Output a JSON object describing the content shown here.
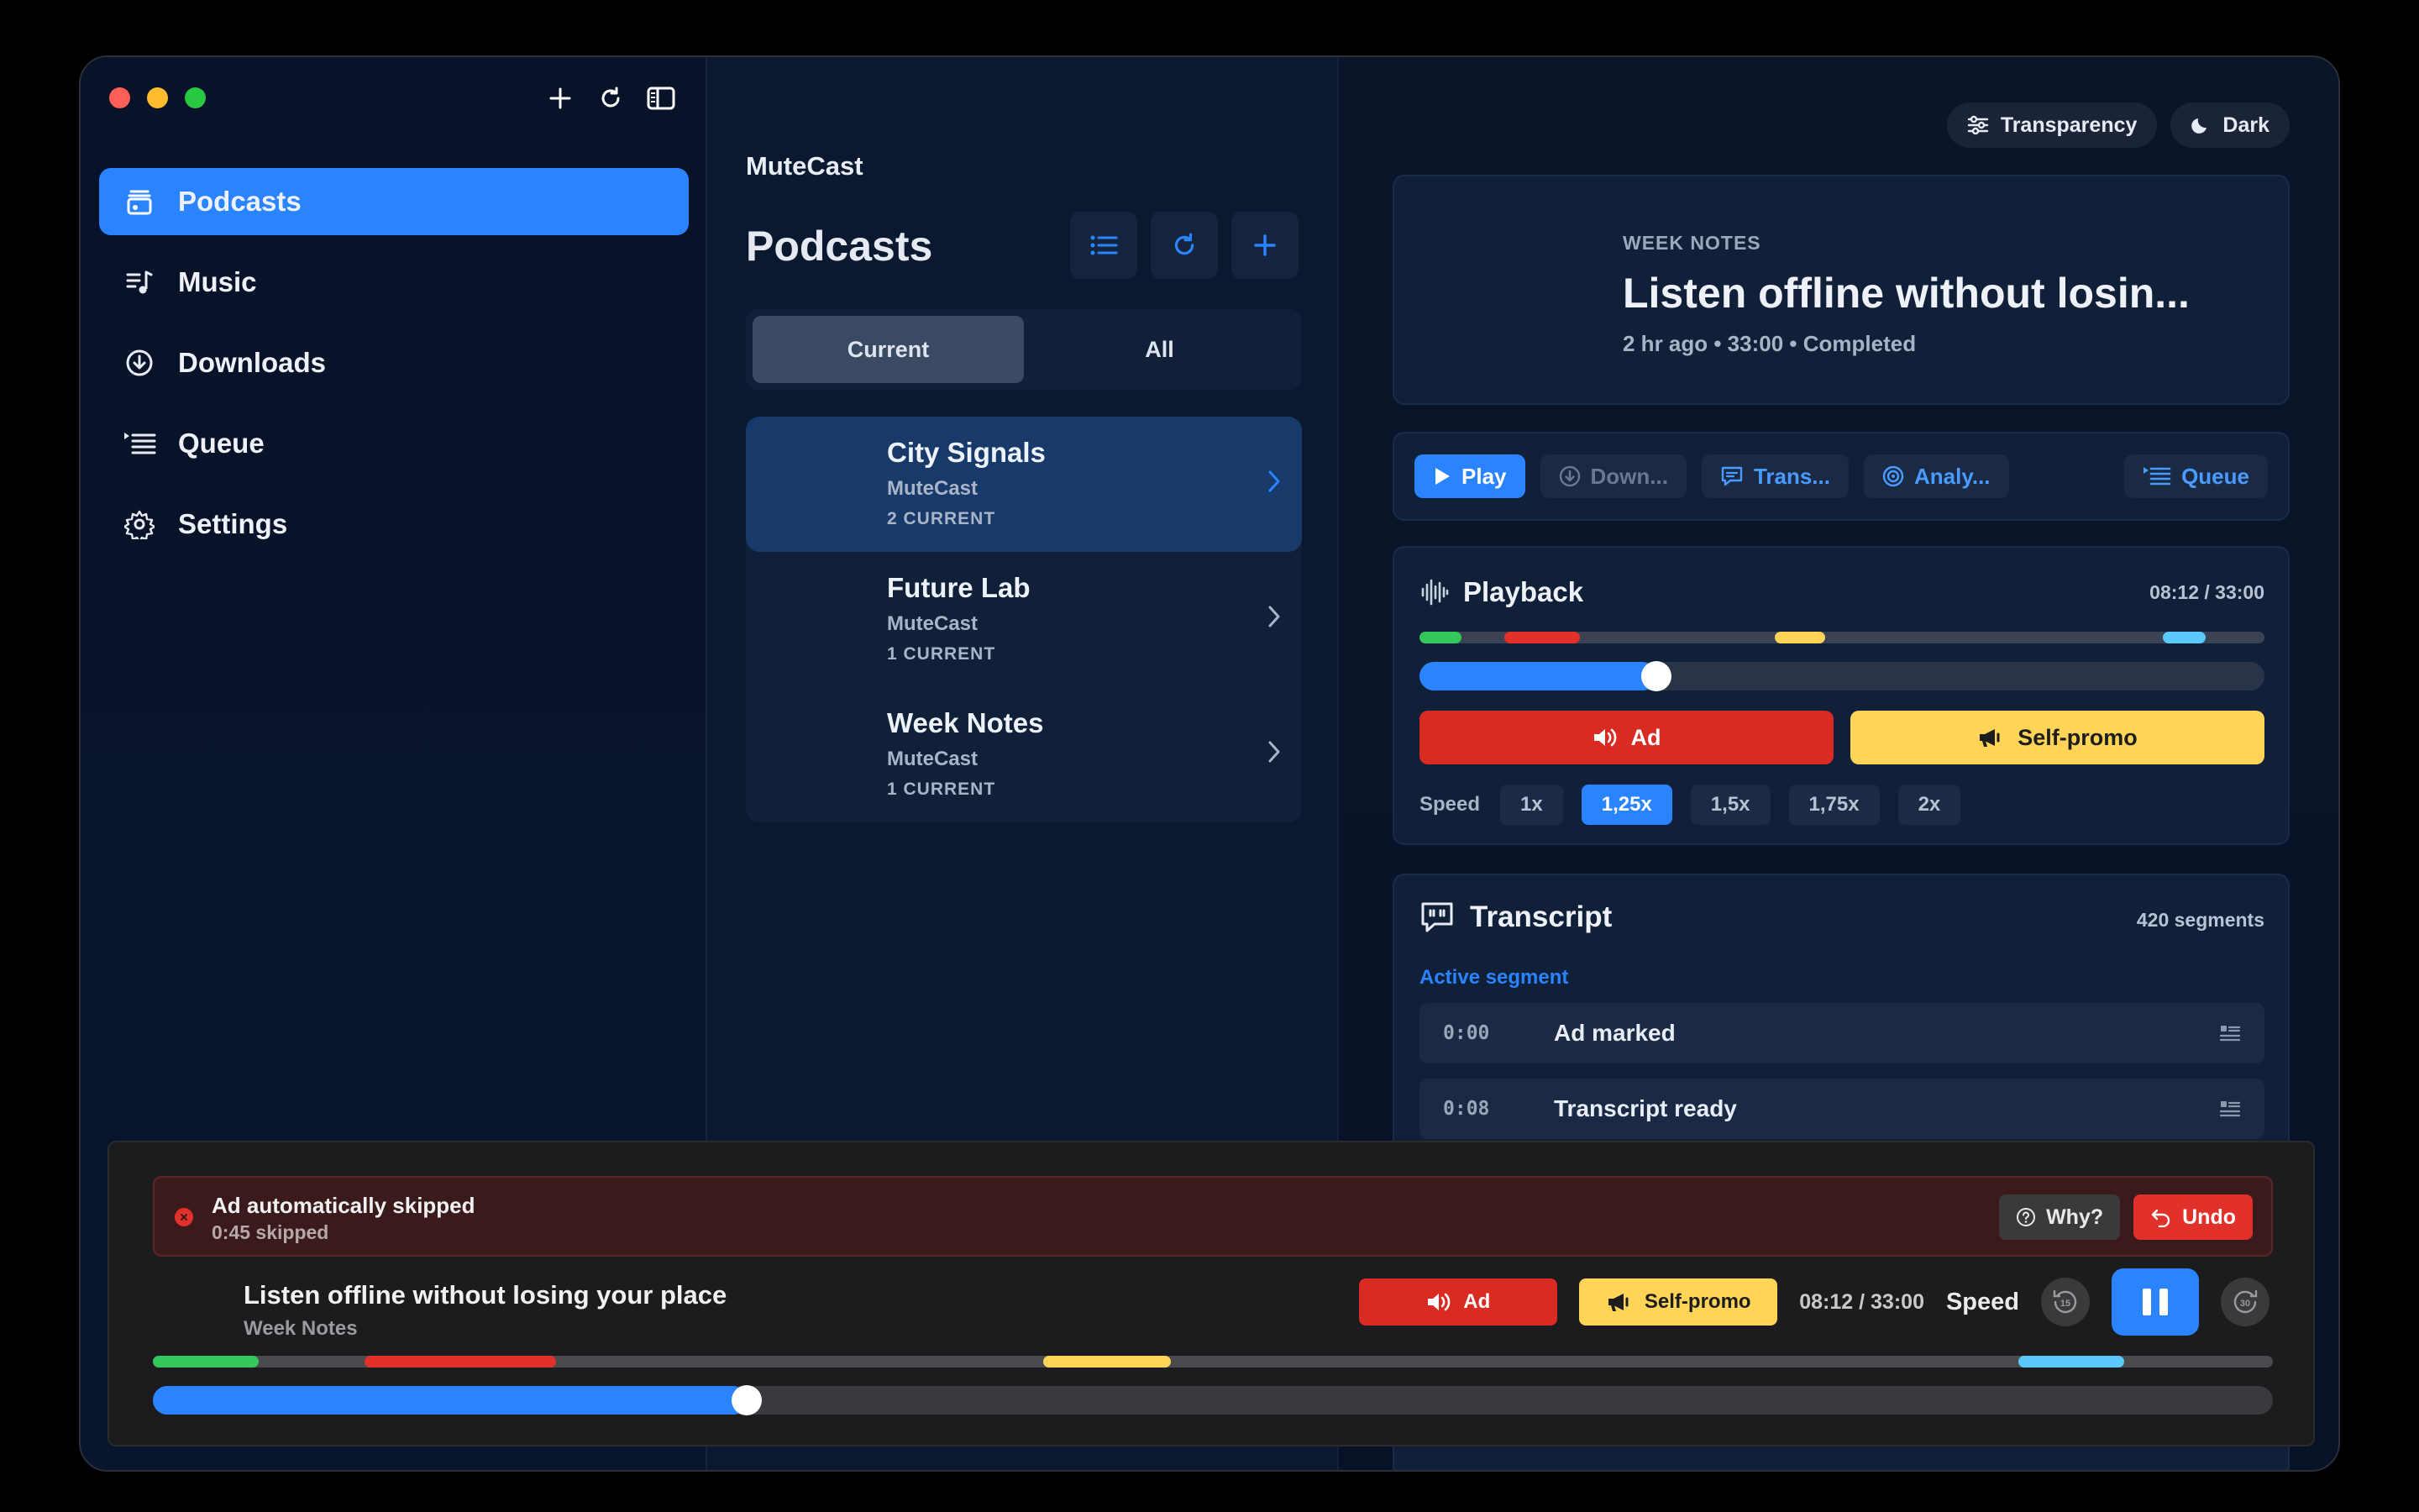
{
  "sidebar": {
    "items": [
      {
        "label": "Podcasts",
        "icon": "podcasts-icon",
        "active": true
      },
      {
        "label": "Music",
        "icon": "music-icon"
      },
      {
        "label": "Downloads",
        "icon": "downloads-icon"
      },
      {
        "label": "Queue",
        "icon": "queue-icon"
      },
      {
        "label": "Settings",
        "icon": "settings-icon"
      }
    ]
  },
  "middle": {
    "app_name": "MuteCast",
    "title": "Podcasts",
    "tabs": [
      "Current",
      "All"
    ],
    "podcasts": [
      {
        "name": "City Signals",
        "publisher": "MuteCast",
        "count": "2 CURRENT"
      },
      {
        "name": "Future Lab",
        "publisher": "MuteCast",
        "count": "1 CURRENT"
      },
      {
        "name": "Week Notes",
        "publisher": "MuteCast",
        "count": "1 CURRENT"
      }
    ]
  },
  "right": {
    "pills": {
      "transparency": "Transparency",
      "theme": "Dark"
    },
    "hero": {
      "kicker": "WEEK NOTES",
      "title": "Listen offline without losin...",
      "meta": "2 hr ago • 33:00 • Completed"
    },
    "actions": {
      "play": "Play",
      "download": "Down...",
      "transcript": "Trans...",
      "analyze": "Analy...",
      "queue": "Queue"
    },
    "playback": {
      "title": "Playback",
      "time": "08:12 / 33:00",
      "progress": 0.28,
      "segments": [
        {
          "type": "intro",
          "color": "#34c759",
          "start": 0.0,
          "end": 0.05
        },
        {
          "type": "ad",
          "color": "#e2312a",
          "start": 0.1,
          "end": 0.19
        },
        {
          "type": "self-promo",
          "color": "#ffd457",
          "start": 0.42,
          "end": 0.48
        },
        {
          "type": "outro",
          "color": "#5ac8fa",
          "start": 0.88,
          "end": 0.93
        }
      ],
      "ad_label": "Ad",
      "selfpromo_label": "Self-promo",
      "speed_label": "Speed",
      "speeds": [
        "1x",
        "1,25x",
        "1,5x",
        "1,75x",
        "2x"
      ],
      "speed_selected": "1,25x"
    },
    "transcript": {
      "title": "Transcript",
      "count": "420 segments",
      "active_label": "Active segment",
      "rows": [
        {
          "time": "0:00",
          "text": "Ad marked"
        },
        {
          "time": "0:08",
          "text": "Transcript ready"
        }
      ]
    }
  },
  "player": {
    "banner": {
      "title": "Ad automatically skipped",
      "subtitle": "0:45 skipped",
      "why": "Why?",
      "undo": "Undo"
    },
    "title": "Listen offline without losing your place",
    "show": "Week Notes",
    "ad_label": "Ad",
    "selfpromo_label": "Self-promo",
    "time": "08:12 / 33:00",
    "speed_label": "Speed",
    "progress": 0.28,
    "segments": [
      {
        "type": "intro",
        "color": "#34c759",
        "start": 0.0,
        "end": 0.05
      },
      {
        "type": "ad",
        "color": "#e2312a",
        "start": 0.1,
        "end": 0.19
      },
      {
        "type": "self-promo",
        "color": "#ffd457",
        "start": 0.42,
        "end": 0.48
      },
      {
        "type": "outro",
        "color": "#5ac8fa",
        "start": 0.88,
        "end": 0.93
      }
    ]
  },
  "colors": {
    "accent": "#2a84ff",
    "ad": "#d92b22",
    "selfpromo": "#ffd457"
  }
}
